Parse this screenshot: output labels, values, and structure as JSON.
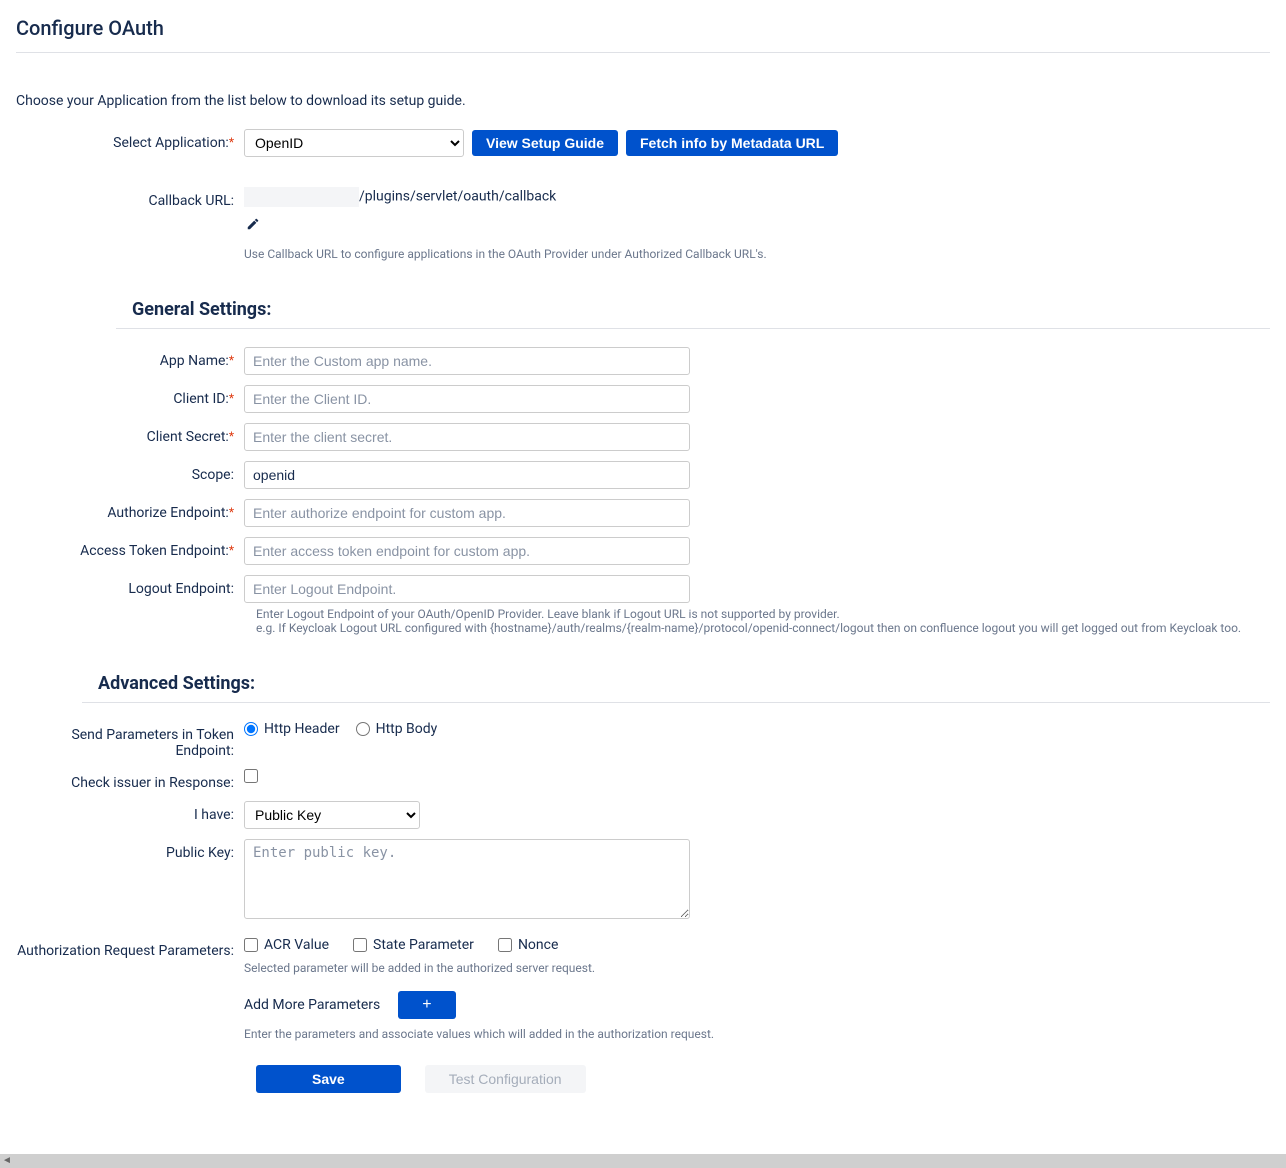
{
  "pageTitle": "Configure OAuth",
  "introText": "Choose your Application from the list below to download its setup guide.",
  "appSelect": {
    "label": "Select Application:",
    "value": "OpenID"
  },
  "buttons": {
    "viewSetupGuide": "View Setup Guide",
    "fetchMetadata": "Fetch info by Metadata URL",
    "save": "Save",
    "testConfig": "Test Configuration",
    "plus": "+"
  },
  "callback": {
    "label": "Callback URL:",
    "suffix": "/plugins/servlet/oauth/callback",
    "help": "Use Callback URL to configure applications in the OAuth Provider under Authorized Callback URL's."
  },
  "sections": {
    "general": "General Settings:",
    "advanced": "Advanced Settings:"
  },
  "general": {
    "appName": {
      "label": "App Name:",
      "placeholder": "Enter the Custom app name."
    },
    "clientId": {
      "label": "Client ID:",
      "placeholder": "Enter the Client ID."
    },
    "clientSecret": {
      "label": "Client Secret:",
      "placeholder": "Enter the client secret."
    },
    "scope": {
      "label": "Scope:",
      "value": "openid"
    },
    "authorizeEndpoint": {
      "label": "Authorize Endpoint:",
      "placeholder": "Enter authorize endpoint for custom app."
    },
    "accessTokenEndpoint": {
      "label": "Access Token Endpoint:",
      "placeholder": "Enter access token endpoint for custom app."
    },
    "logoutEndpoint": {
      "label": "Logout Endpoint:",
      "placeholder": "Enter Logout Endpoint."
    },
    "logoutHelp1": "Enter Logout Endpoint of your OAuth/OpenID Provider. Leave blank if Logout URL is not supported by provider.",
    "logoutHelp2": "e.g. If Keycloak Logout URL configured with {hostname}/auth/realms/{realm-name}/protocol/openid-connect/logout then on confluence logout you will get logged out from Keycloak too."
  },
  "advanced": {
    "sendParams": {
      "label": "Send Parameters in Token Endpoint:",
      "option1": "Http Header",
      "option2": "Http Body",
      "selected": "header"
    },
    "checkIssuer": {
      "label": "Check issuer in Response:"
    },
    "iHave": {
      "label": "I have:",
      "value": "Public Key"
    },
    "publicKey": {
      "label": "Public Key:",
      "placeholder": "Enter public key."
    },
    "authParams": {
      "label": "Authorization Request Parameters:",
      "acr": "ACR Value",
      "state": "State Parameter",
      "nonce": "Nonce",
      "help": "Selected parameter will be added in the authorized server request."
    },
    "addMore": {
      "label": "Add More Parameters",
      "help": "Enter the parameters and associate values which will added in the authorization request."
    }
  }
}
